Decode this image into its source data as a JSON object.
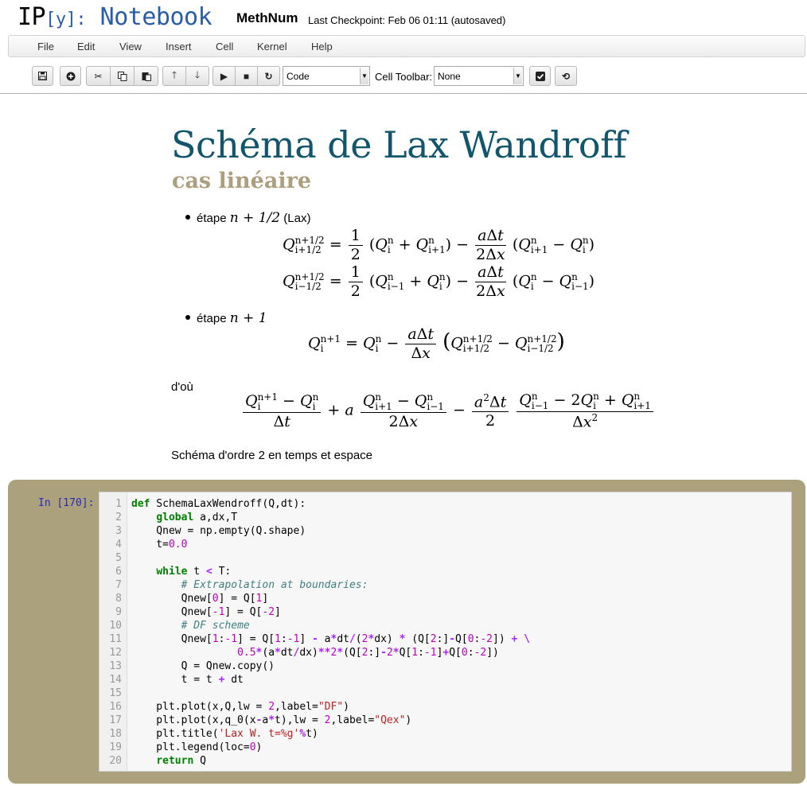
{
  "header": {
    "logo_ip": "IP",
    "logo_y": "[y]:",
    "logo_notebook": "Notebook",
    "notebook_name": "MethNum",
    "checkpoint": "Last Checkpoint: Feb 06 01:11 (autosaved)"
  },
  "menu": [
    "File",
    "Edit",
    "View",
    "Insert",
    "Cell",
    "Kernel",
    "Help"
  ],
  "toolbar": {
    "cell_type": "Code",
    "cell_toolbar_label": "Cell Toolbar:",
    "cell_toolbar_value": "None"
  },
  "markdown": {
    "title": "Schéma de Lax Wandroff",
    "subtitle": "cas linéaire",
    "bullet1_text": "étape",
    "bullet1_math": "n + 1/2",
    "bullet1_suffix": "(Lax)",
    "bullet2_text": "étape",
    "bullet2_math": "n + 1",
    "dou": "d'où",
    "conclusion": "Schéma d'ordre 2 en temps et espace"
  },
  "cell": {
    "prompt": "In [170]:",
    "line_numbers": [
      "1",
      "2",
      "3",
      "4",
      "5",
      "6",
      "7",
      "8",
      "9",
      "10",
      "11",
      "12",
      "13",
      "14",
      "15",
      "16",
      "17",
      "18",
      "19",
      "20"
    ]
  },
  "colors": {
    "title": "#12566e",
    "subtitle": "#ad9f7e",
    "cell_bg": "#aba27d",
    "keyword": "#008000",
    "comment": "#408080",
    "number": "#c000c0",
    "string": "#ba2121"
  }
}
